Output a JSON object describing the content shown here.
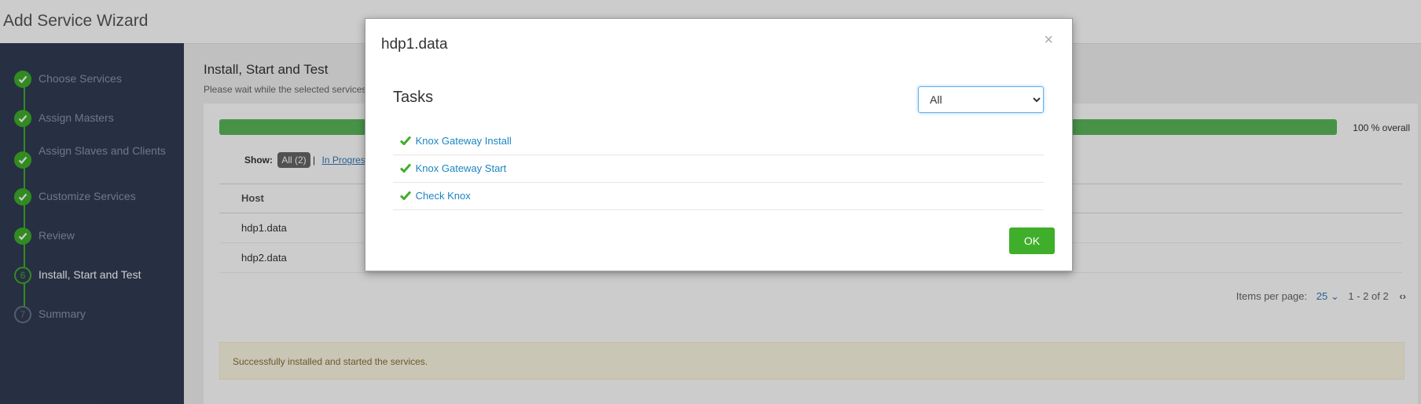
{
  "app": {
    "title": "Add Service Wizard"
  },
  "sidebar": {
    "steps": [
      {
        "label": "Choose Services",
        "status": "done"
      },
      {
        "label": "Assign Masters",
        "status": "done"
      },
      {
        "label": "Assign Slaves and Clients",
        "status": "done"
      },
      {
        "label": "Customize Services",
        "status": "done"
      },
      {
        "label": "Review",
        "status": "done"
      },
      {
        "label": "Install, Start and Test",
        "number": "6",
        "status": "current"
      },
      {
        "label": "Summary",
        "number": "7",
        "status": "todo"
      }
    ]
  },
  "main": {
    "heading": "Install, Start and Test",
    "subheading": "Please wait while the selected services",
    "progress": {
      "percent": 100,
      "label": "100 % overall"
    },
    "filter": {
      "show_label": "Show:",
      "all_label": "All (2)",
      "separator": "|",
      "in_progress_label": "In Progress"
    },
    "table": {
      "header": "Host",
      "rows": [
        "hdp1.data",
        "hdp2.data"
      ]
    },
    "pager": {
      "items_label": "Items per page:",
      "per_page": "25",
      "range": "1 - 2 of 2"
    },
    "notice": "Successfully installed and started the services."
  },
  "modal": {
    "title": "hdp1.data",
    "close": "×",
    "tasks_title": "Tasks",
    "filter_selected": "All",
    "tasks": [
      {
        "name": "Knox Gateway Install",
        "status": "success"
      },
      {
        "name": "Knox Gateway Start",
        "status": "success"
      },
      {
        "name": "Check Knox",
        "status": "success"
      }
    ],
    "ok_label": "OK"
  },
  "colors": {
    "success": "#3fae2a",
    "link": "#1b85c0",
    "sidebar": "#313d54"
  }
}
